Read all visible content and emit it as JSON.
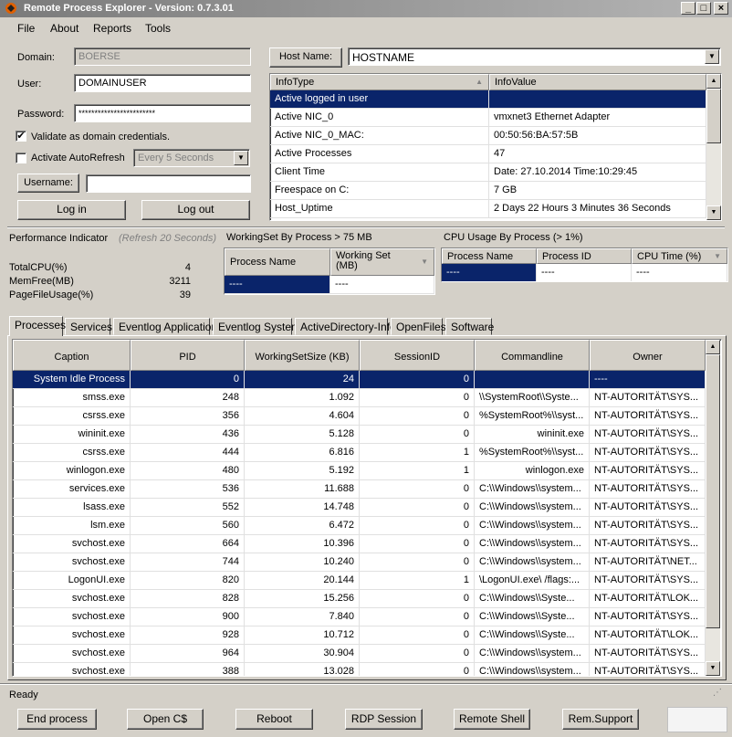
{
  "window": {
    "title": "Remote Process Explorer - Version: 0.7.3.01",
    "min_glyph": "_",
    "max_glyph": "□",
    "close_glyph": "×"
  },
  "menu": [
    "File",
    "About",
    "Reports",
    "Tools"
  ],
  "login": {
    "domain_label": "Domain:",
    "domain_value": "BOERSE",
    "user_label": "User:",
    "user_value": "DOMAINUSER",
    "password_label": "Password:",
    "password_value": "************************",
    "validate_label": "Validate as domain credentials.",
    "validate_checked": true,
    "autorefresh_label": "Activate AutoRefresh",
    "autorefresh_checked": false,
    "refresh_interval": "Every 5 Seconds",
    "username_button": "Username:",
    "username_value": "",
    "login_button": "Log in",
    "logout_button": "Log out"
  },
  "host": {
    "button_label": "Host Name:",
    "value": "HOSTNAME"
  },
  "info_table": {
    "headers": [
      "InfoType",
      "InfoValue"
    ],
    "rows": [
      [
        "Active logged in user",
        ""
      ],
      [
        "Active NIC_0",
        "vmxnet3 Ethernet Adapter"
      ],
      [
        "Active NIC_0_MAC:",
        "00:50:56:BA:57:5B"
      ],
      [
        "Active Processes",
        "47"
      ],
      [
        "Client Time",
        "Date: 27.10.2014 Time:10:29:45"
      ],
      [
        "Freespace on C:",
        "7 GB"
      ],
      [
        "Host_Uptime",
        "2 Days 22 Hours 3 Minutes 36 Seconds"
      ]
    ]
  },
  "performance": {
    "title": "Performance Indicator",
    "refresh_note": "(Refresh 20 Seconds)",
    "items": [
      {
        "label": "TotalCPU(%)",
        "value": "4"
      },
      {
        "label": "MemFree(MB)",
        "value": "3211"
      },
      {
        "label": "PageFileUsage(%)",
        "value": "39"
      }
    ]
  },
  "workingset": {
    "title": "WorkingSet By Process > 75 MB",
    "headers": [
      "Process Name",
      "Working Set (MB)"
    ],
    "rows": [
      [
        "----",
        "----"
      ]
    ]
  },
  "cpu_usage": {
    "title": "CPU Usage By Process (> 1%)",
    "headers": [
      "Process Name",
      "Process ID",
      "CPU Time (%)"
    ],
    "rows": [
      [
        "----",
        "----",
        "----"
      ]
    ]
  },
  "tabs": [
    "Processes",
    "Services",
    "Eventlog Application",
    "Eventlog System",
    "ActiveDirectory-Info",
    "OpenFiles",
    "Software"
  ],
  "processes": {
    "headers": [
      "Caption",
      "PID",
      "WorkingSetSize (KB)",
      "SessionID",
      "Commandline",
      "Owner"
    ],
    "rows": [
      [
        "System Idle Process",
        "0",
        "24",
        "0",
        "",
        "----"
      ],
      [
        "smss.exe",
        "248",
        "1.092",
        "0",
        "\\\\SystemRoot\\\\Syste...",
        "NT-AUTORITÄT\\SYS..."
      ],
      [
        "csrss.exe",
        "356",
        "4.604",
        "0",
        "%SystemRoot%\\\\syst...",
        "NT-AUTORITÄT\\SYS..."
      ],
      [
        "wininit.exe",
        "436",
        "5.128",
        "0",
        "wininit.exe",
        "NT-AUTORITÄT\\SYS..."
      ],
      [
        "csrss.exe",
        "444",
        "6.816",
        "1",
        "%SystemRoot%\\\\syst...",
        "NT-AUTORITÄT\\SYS..."
      ],
      [
        "winlogon.exe",
        "480",
        "5.192",
        "1",
        "winlogon.exe",
        "NT-AUTORITÄT\\SYS..."
      ],
      [
        "services.exe",
        "536",
        "11.688",
        "0",
        "C:\\\\Windows\\\\system...",
        "NT-AUTORITÄT\\SYS..."
      ],
      [
        "lsass.exe",
        "552",
        "14.748",
        "0",
        "C:\\\\Windows\\\\system...",
        "NT-AUTORITÄT\\SYS..."
      ],
      [
        "lsm.exe",
        "560",
        "6.472",
        "0",
        "C:\\\\Windows\\\\system...",
        "NT-AUTORITÄT\\SYS..."
      ],
      [
        "svchost.exe",
        "664",
        "10.396",
        "0",
        "C:\\\\Windows\\\\system...",
        "NT-AUTORITÄT\\SYS..."
      ],
      [
        "svchost.exe",
        "744",
        "10.240",
        "0",
        "C:\\\\Windows\\\\system...",
        "NT-AUTORITÄT\\NET..."
      ],
      [
        "LogonUI.exe",
        "820",
        "20.144",
        "1",
        "\\LogonUI.exe\\ /flags:...",
        "NT-AUTORITÄT\\SYS..."
      ],
      [
        "svchost.exe",
        "828",
        "15.256",
        "0",
        "C:\\\\Windows\\\\Syste...",
        "NT-AUTORITÄT\\LOK..."
      ],
      [
        "svchost.exe",
        "900",
        "7.840",
        "0",
        "C:\\\\Windows\\\\Syste...",
        "NT-AUTORITÄT\\SYS..."
      ],
      [
        "svchost.exe",
        "928",
        "10.712",
        "0",
        "C:\\\\Windows\\\\Syste...",
        "NT-AUTORITÄT\\LOK..."
      ],
      [
        "svchost.exe",
        "964",
        "30.904",
        "0",
        "C:\\\\Windows\\\\system...",
        "NT-AUTORITÄT\\SYS..."
      ],
      [
        "svchost.exe",
        "388",
        "13.028",
        "0",
        "C:\\\\Windows\\\\system...",
        "NT-AUTORITÄT\\SYS..."
      ]
    ]
  },
  "status": {
    "text": "Ready"
  },
  "bottom_buttons": [
    "End process",
    "Open C$",
    "Reboot",
    "RDP Session",
    "Remote Shell",
    "Rem.Support"
  ]
}
